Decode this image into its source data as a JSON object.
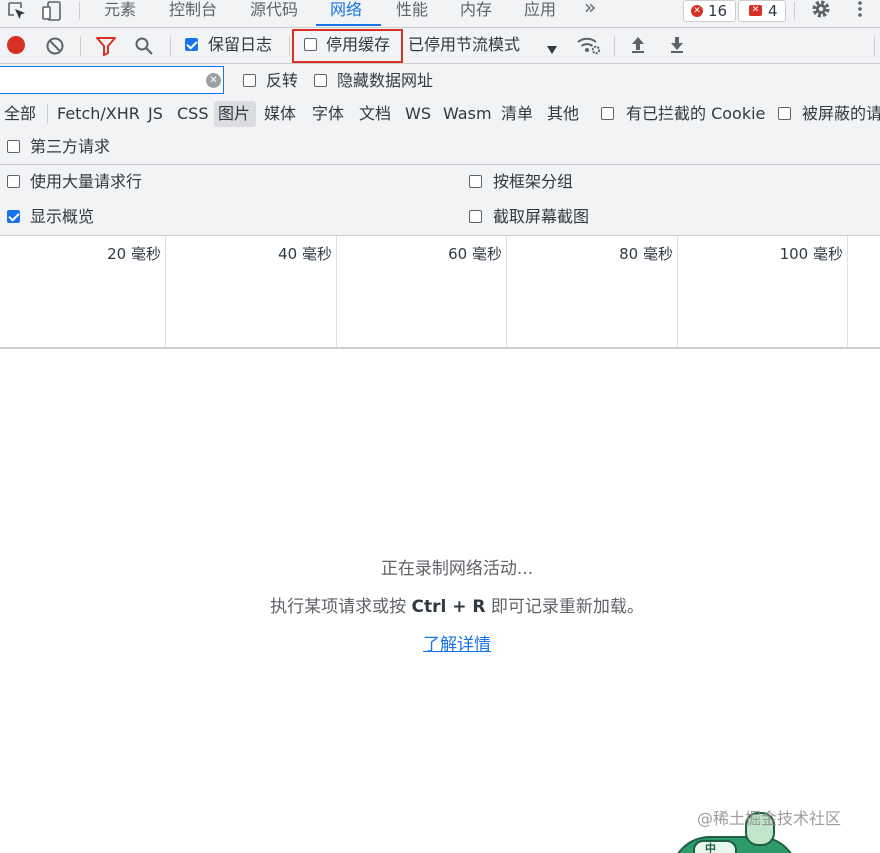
{
  "tabs": {
    "items": [
      "元素",
      "控制台",
      "源代码",
      "网络",
      "性能",
      "内存",
      "应用"
    ],
    "more": "»",
    "errors_count": "16",
    "warnings_count": "4"
  },
  "toolbar": {
    "preserve_log": "保留日志",
    "disable_cache": "停用缓存",
    "throttling": "已停用节流模式"
  },
  "filter_row": {
    "input_value": "",
    "invert": "反转",
    "hide_data_urls": "隐藏数据网址"
  },
  "types": {
    "all": "全部",
    "fetch_xhr": "Fetch/XHR",
    "js": "JS",
    "css": "CSS",
    "img": "图片",
    "media": "媒体",
    "font": "字体",
    "doc": "文档",
    "ws": "WS",
    "wasm": "Wasm",
    "manifest": "清单",
    "other": "其他",
    "blocked_cookies": "有已拦截的 Cookie",
    "blocked_requests": "被屏蔽的请",
    "third_party": "第三方请求"
  },
  "settings": {
    "large_rows": "使用大量请求行",
    "group_by_frame": "按框架分组",
    "show_overview": "显示概览",
    "capture_screenshots": "截取屏幕截图"
  },
  "timeline": {
    "ticks": [
      "20 毫秒",
      "40 毫秒",
      "60 毫秒",
      "80 毫秒",
      "100 毫秒"
    ]
  },
  "empty": {
    "recording": "正在录制网络活动...",
    "hint_prefix": "执行某项请求或按 ",
    "hint_keys": "Ctrl + R",
    "hint_suffix": " 即可记录重新加载。",
    "learn_more": "了解详情"
  },
  "watermark": "@稀土掘金技术社区",
  "mascot_char": "中",
  "colors": {
    "accent": "#1a73e8",
    "record": "#d93025",
    "highlight_box": "#d93025",
    "toolbar_bg": "#f1f3f4"
  }
}
